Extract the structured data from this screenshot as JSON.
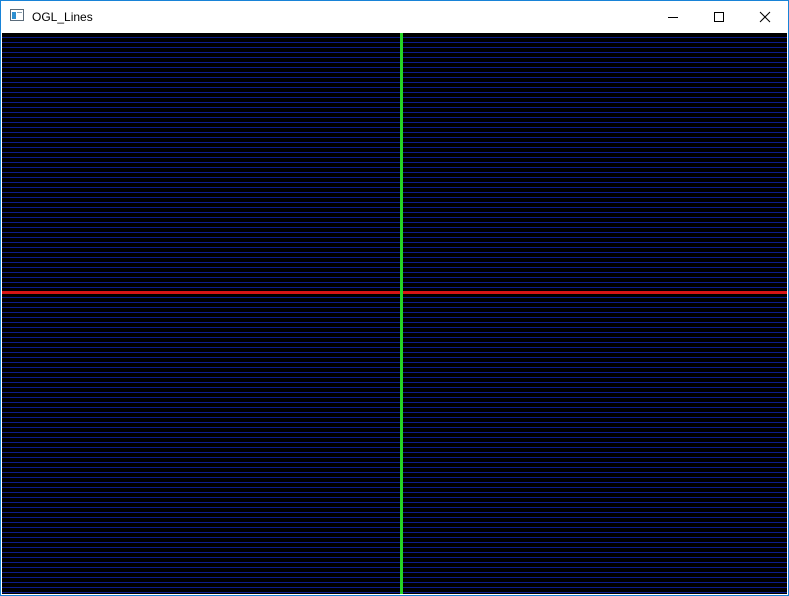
{
  "window": {
    "title": "OGL_Lines"
  },
  "titlebar_buttons": {
    "minimize": "minimize-icon",
    "maximize": "maximize-icon",
    "close": "close-icon"
  },
  "canvas": {
    "background_color": "#000000",
    "grid_line_color": "#0c1d8c",
    "x_axis_color": "#d71515",
    "y_axis_color": "#25d325"
  }
}
